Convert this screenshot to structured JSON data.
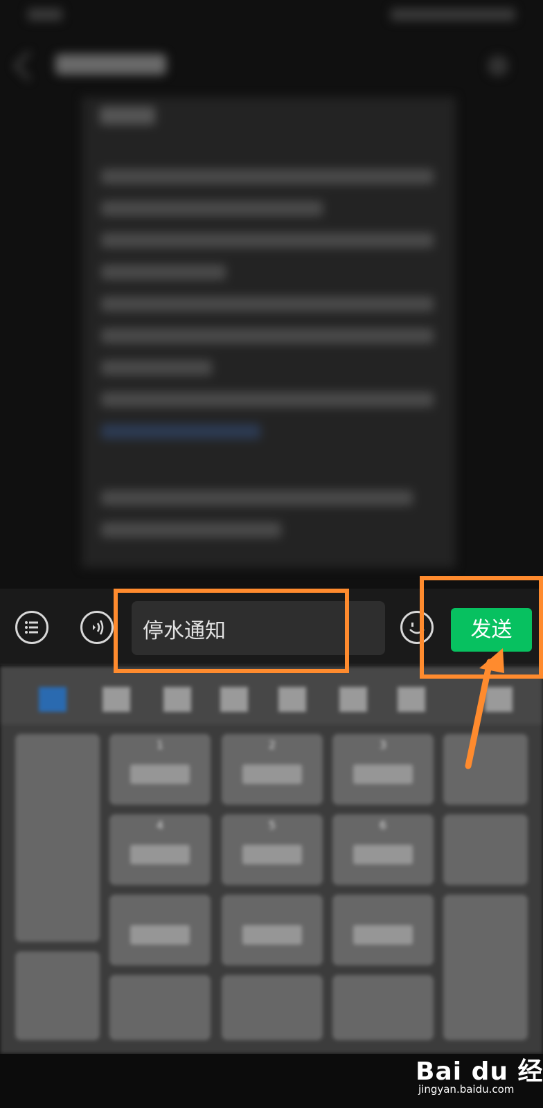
{
  "input_bar": {
    "message_text": "停水通知",
    "send_label": "发送"
  },
  "keyboard": {
    "keys": [
      {
        "number": "1"
      },
      {
        "number": "2"
      },
      {
        "number": "3"
      },
      {
        "number": "4"
      },
      {
        "number": "5"
      },
      {
        "number": "6"
      }
    ]
  },
  "watermark": {
    "logo": "Bai du 经验",
    "url": "jingyan.baidu.com"
  },
  "colors": {
    "send_button": "#07c160",
    "annotation": "#ff8b2e"
  }
}
